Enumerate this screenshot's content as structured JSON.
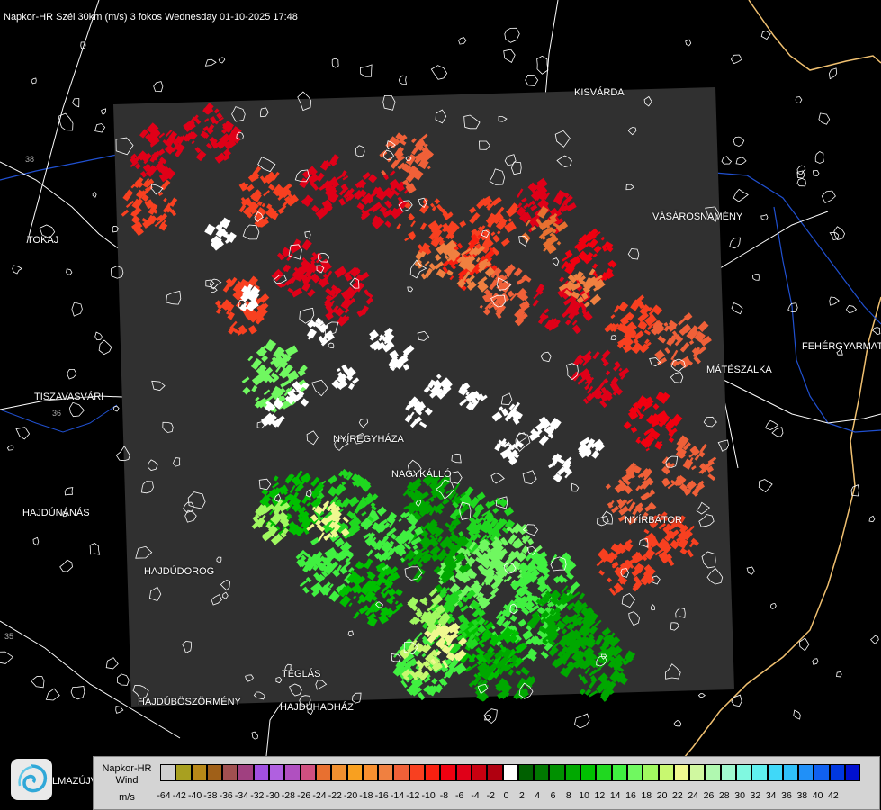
{
  "header": {
    "title": "Napkor-HR Szél 30km (m/s) 3 fokos Wednesday 01-10-2025 17:48"
  },
  "cities": [
    {
      "name": "KISVÁRDA"
    },
    {
      "name": "VÁSÁROSNAMÉNY"
    },
    {
      "name": "TOKAJ"
    },
    {
      "name": "FEHÉRGYARMAT"
    },
    {
      "name": "MÁTÉSZALKA"
    },
    {
      "name": "TISZAVASVÁRI"
    },
    {
      "name": "NYÍREGYHÁZA"
    },
    {
      "name": "NAGYKÁLLÓ"
    },
    {
      "name": "HAJDÚNÁNÁS"
    },
    {
      "name": "NYÍRBÁTOR"
    },
    {
      "name": "HAJDÚDOROG"
    },
    {
      "name": "TÉGLÁS"
    },
    {
      "name": "HAJDÚBÖSZÖRMÉNY"
    },
    {
      "name": "HAJDÚHADHÁZ"
    },
    {
      "name": "LMAZÚJVÁR"
    }
  ],
  "road_numbers": [
    "38",
    "36",
    "35"
  ],
  "legend": {
    "title_line1": "Napkor-HR",
    "title_line2": "Wind",
    "title_line3": "m/s",
    "colors": [
      "#d0d0d0",
      "#a8a020",
      "#b88818",
      "#a06018",
      "#a05050",
      "#a04080",
      "#a050e0",
      "#b060e0",
      "#b050c0",
      "#d05080",
      "#e87030",
      "#f09030",
      "#f8a020",
      "#f89030",
      "#f08040",
      "#f06038",
      "#f84020",
      "#f82010",
      "#f00010",
      "#e00018",
      "#c80010",
      "#b00010",
      "#ffffff",
      "#006000",
      "#007800",
      "#009000",
      "#00a800",
      "#00c000",
      "#20d820",
      "#40f040",
      "#70f860",
      "#a0f860",
      "#c8f870",
      "#f0f890",
      "#d0f8a0",
      "#b0f8b0",
      "#a0f8d0",
      "#80f8e0",
      "#60f0f0",
      "#40d8f8",
      "#30c0f8",
      "#2090f8",
      "#1060f0",
      "#0038e0",
      "#0010d0"
    ],
    "labels": [
      "-64",
      "-42",
      "-40",
      "-38",
      "-36",
      "-34",
      "-32",
      "-30",
      "-28",
      "-26",
      "-24",
      "-22",
      "-20",
      "-18",
      "-16",
      "-14",
      "-12",
      "-10",
      "-8",
      "-6",
      "-4",
      "-2",
      "0",
      "2",
      "4",
      "6",
      "8",
      "10",
      "12",
      "14",
      "16",
      "18",
      "20",
      "22",
      "24",
      "26",
      "28",
      "30",
      "32",
      "34",
      "36",
      "38",
      "40",
      "42"
    ]
  },
  "colors": {
    "radar_bg": "#303030",
    "roads": "#ffffff",
    "rivers": "#2050d0",
    "border": "#f0c070"
  }
}
